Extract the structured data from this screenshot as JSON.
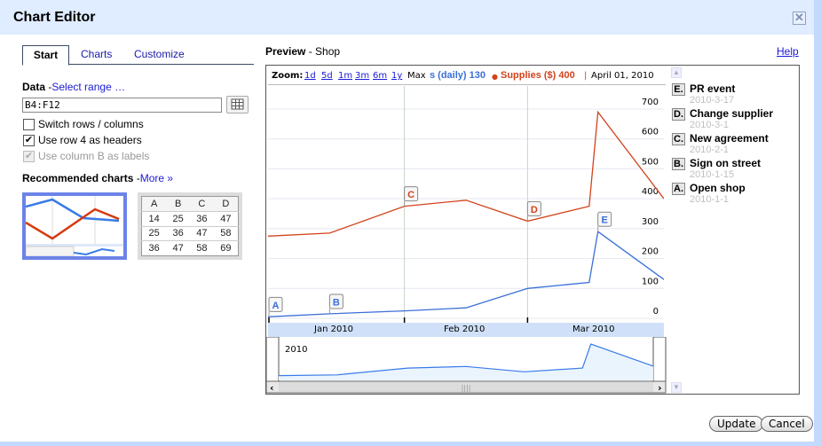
{
  "dialog": {
    "title": "Chart Editor",
    "close_icon": "close-icon"
  },
  "tabs": [
    {
      "label": "Start",
      "active": true
    },
    {
      "label": "Charts",
      "active": false
    },
    {
      "label": "Customize",
      "active": false
    }
  ],
  "data_section": {
    "label": "Data",
    "separator": "-",
    "select_range_link": "Select range …",
    "range_value": "B4:F12",
    "grid_button_icon": "grid-icon",
    "options": [
      {
        "label": "Switch rows / columns",
        "checked": false,
        "disabled": false
      },
      {
        "label": "Use row 4 as headers",
        "checked": true,
        "disabled": false
      },
      {
        "label": "Use column B as labels",
        "checked": true,
        "disabled": true
      }
    ]
  },
  "recommended": {
    "label": "Recommended charts",
    "separator": "-",
    "more_link": "More »",
    "table_preview": [
      [
        "A",
        "B",
        "C",
        "D"
      ],
      [
        "14",
        "25",
        "36",
        "47"
      ],
      [
        "25",
        "36",
        "47",
        "58"
      ],
      [
        "36",
        "47",
        "58",
        "69"
      ]
    ]
  },
  "preview": {
    "label": "Preview",
    "separator": " - ",
    "sheet_name": "Shop",
    "help_link": "Help"
  },
  "chart_toolbar": {
    "zoom_label": "Zoom:",
    "zoom_links": [
      "1d",
      "5d",
      "1m",
      "3m",
      "6m",
      "1y"
    ],
    "zoom_max": "Max",
    "legend_blue": "s (daily) 130",
    "legend_red_dot": "●",
    "legend_red": "Supplies ($) 400",
    "pipe": "|",
    "current_date": "April 01, 2010"
  },
  "colors": {
    "blue_series": "#3a6fd8",
    "red_series": "#d2431c",
    "date_axis_bg": "#cfe0f8",
    "title_bg": "#e0ecff",
    "page_bg": "#c3d9ff"
  },
  "chart_data": {
    "type": "line",
    "title": "",
    "x_tick_labels": [
      "Jan 2010",
      "Feb 2010",
      "Mar 2010"
    ],
    "y_tick_labels": [
      "0",
      "100",
      "200",
      "300",
      "400",
      "500",
      "600",
      "700"
    ],
    "ylim": [
      0,
      700
    ],
    "x": [
      "2010-01-01",
      "2010-01-15",
      "2010-02-01",
      "2010-02-15",
      "2010-03-01",
      "2010-03-15",
      "2010-03-17",
      "2010-04-01"
    ],
    "series": [
      {
        "name": "Sales (daily)",
        "color": "#3a6fd8",
        "values": [
          5,
          15,
          25,
          35,
          100,
          120,
          290,
          130
        ]
      },
      {
        "name": "Supplies ($)",
        "color": "#d2431c",
        "values": [
          275,
          285,
          375,
          395,
          325,
          375,
          690,
          400
        ]
      }
    ],
    "annotations": [
      {
        "letter": "A",
        "series": "Sales (daily)",
        "x": "2010-01-01"
      },
      {
        "letter": "B",
        "series": "Sales (daily)",
        "x": "2010-01-15"
      },
      {
        "letter": "C",
        "series": "Supplies ($)",
        "x": "2010-02-01"
      },
      {
        "letter": "D",
        "series": "Supplies ($)",
        "x": "2010-03-01"
      },
      {
        "letter": "E",
        "series": "Sales (daily)",
        "x": "2010-03-17"
      }
    ],
    "range_selector_label": "2010",
    "grid": true
  },
  "events": [
    {
      "letter": "E.",
      "title": "PR event",
      "date": "2010-3-17"
    },
    {
      "letter": "D.",
      "title": "Change supplier",
      "date": "2010-3-1"
    },
    {
      "letter": "C.",
      "title": "New agreement",
      "date": "2010-2-1"
    },
    {
      "letter": "B.",
      "title": "Sign on street",
      "date": "2010-1-15"
    },
    {
      "letter": "A.",
      "title": "Open shop",
      "date": "2010-1-1"
    }
  ],
  "footer": {
    "update_label": "Update",
    "cancel_label": "Cancel"
  }
}
